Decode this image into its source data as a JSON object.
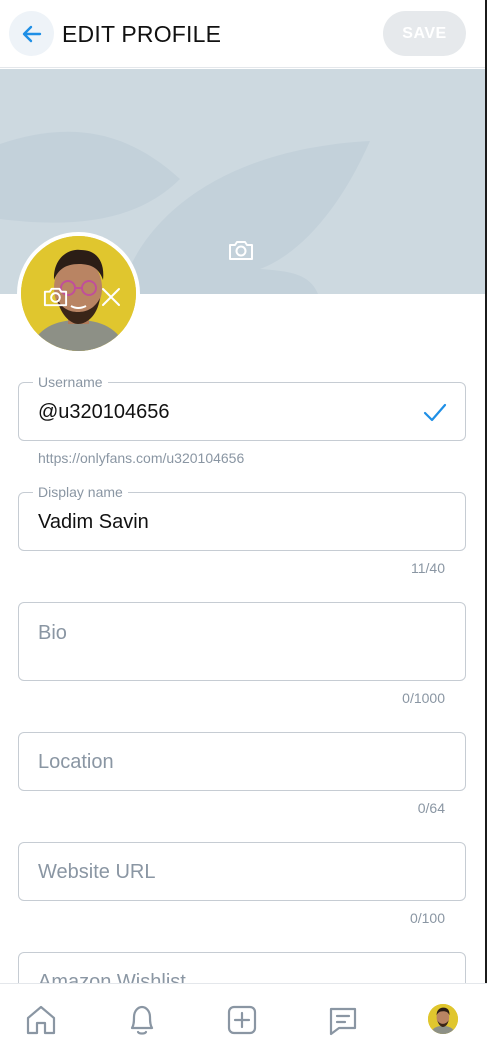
{
  "header": {
    "title": "EDIT PROFILE",
    "save_label": "SAVE"
  },
  "icons": {
    "back": "arrow-left-icon",
    "cover_camera": "camera-icon",
    "avatar_camera": "camera-icon",
    "avatar_remove": "close-icon",
    "username_valid": "check-icon",
    "nav": [
      "home-icon",
      "bell-icon",
      "plus-square-icon",
      "message-icon",
      "avatar"
    ]
  },
  "colors": {
    "accent": "#00aff0",
    "cover": "#cdd9e0",
    "avatar_bg": "#e0c62e",
    "muted_text": "#8a96a3"
  },
  "form": {
    "username": {
      "label": "Username",
      "value": "@u320104656",
      "profile_url": "https://onlyfans.com/u320104656"
    },
    "display_name": {
      "label": "Display name",
      "value": "Vadim Savin",
      "counter": "11/40"
    },
    "bio": {
      "placeholder": "Bio",
      "counter": "0/1000"
    },
    "location": {
      "placeholder": "Location",
      "counter": "0/64"
    },
    "website": {
      "placeholder": "Website URL",
      "counter": "0/100"
    },
    "wishlist": {
      "placeholder": "Amazon Wishlist"
    }
  }
}
